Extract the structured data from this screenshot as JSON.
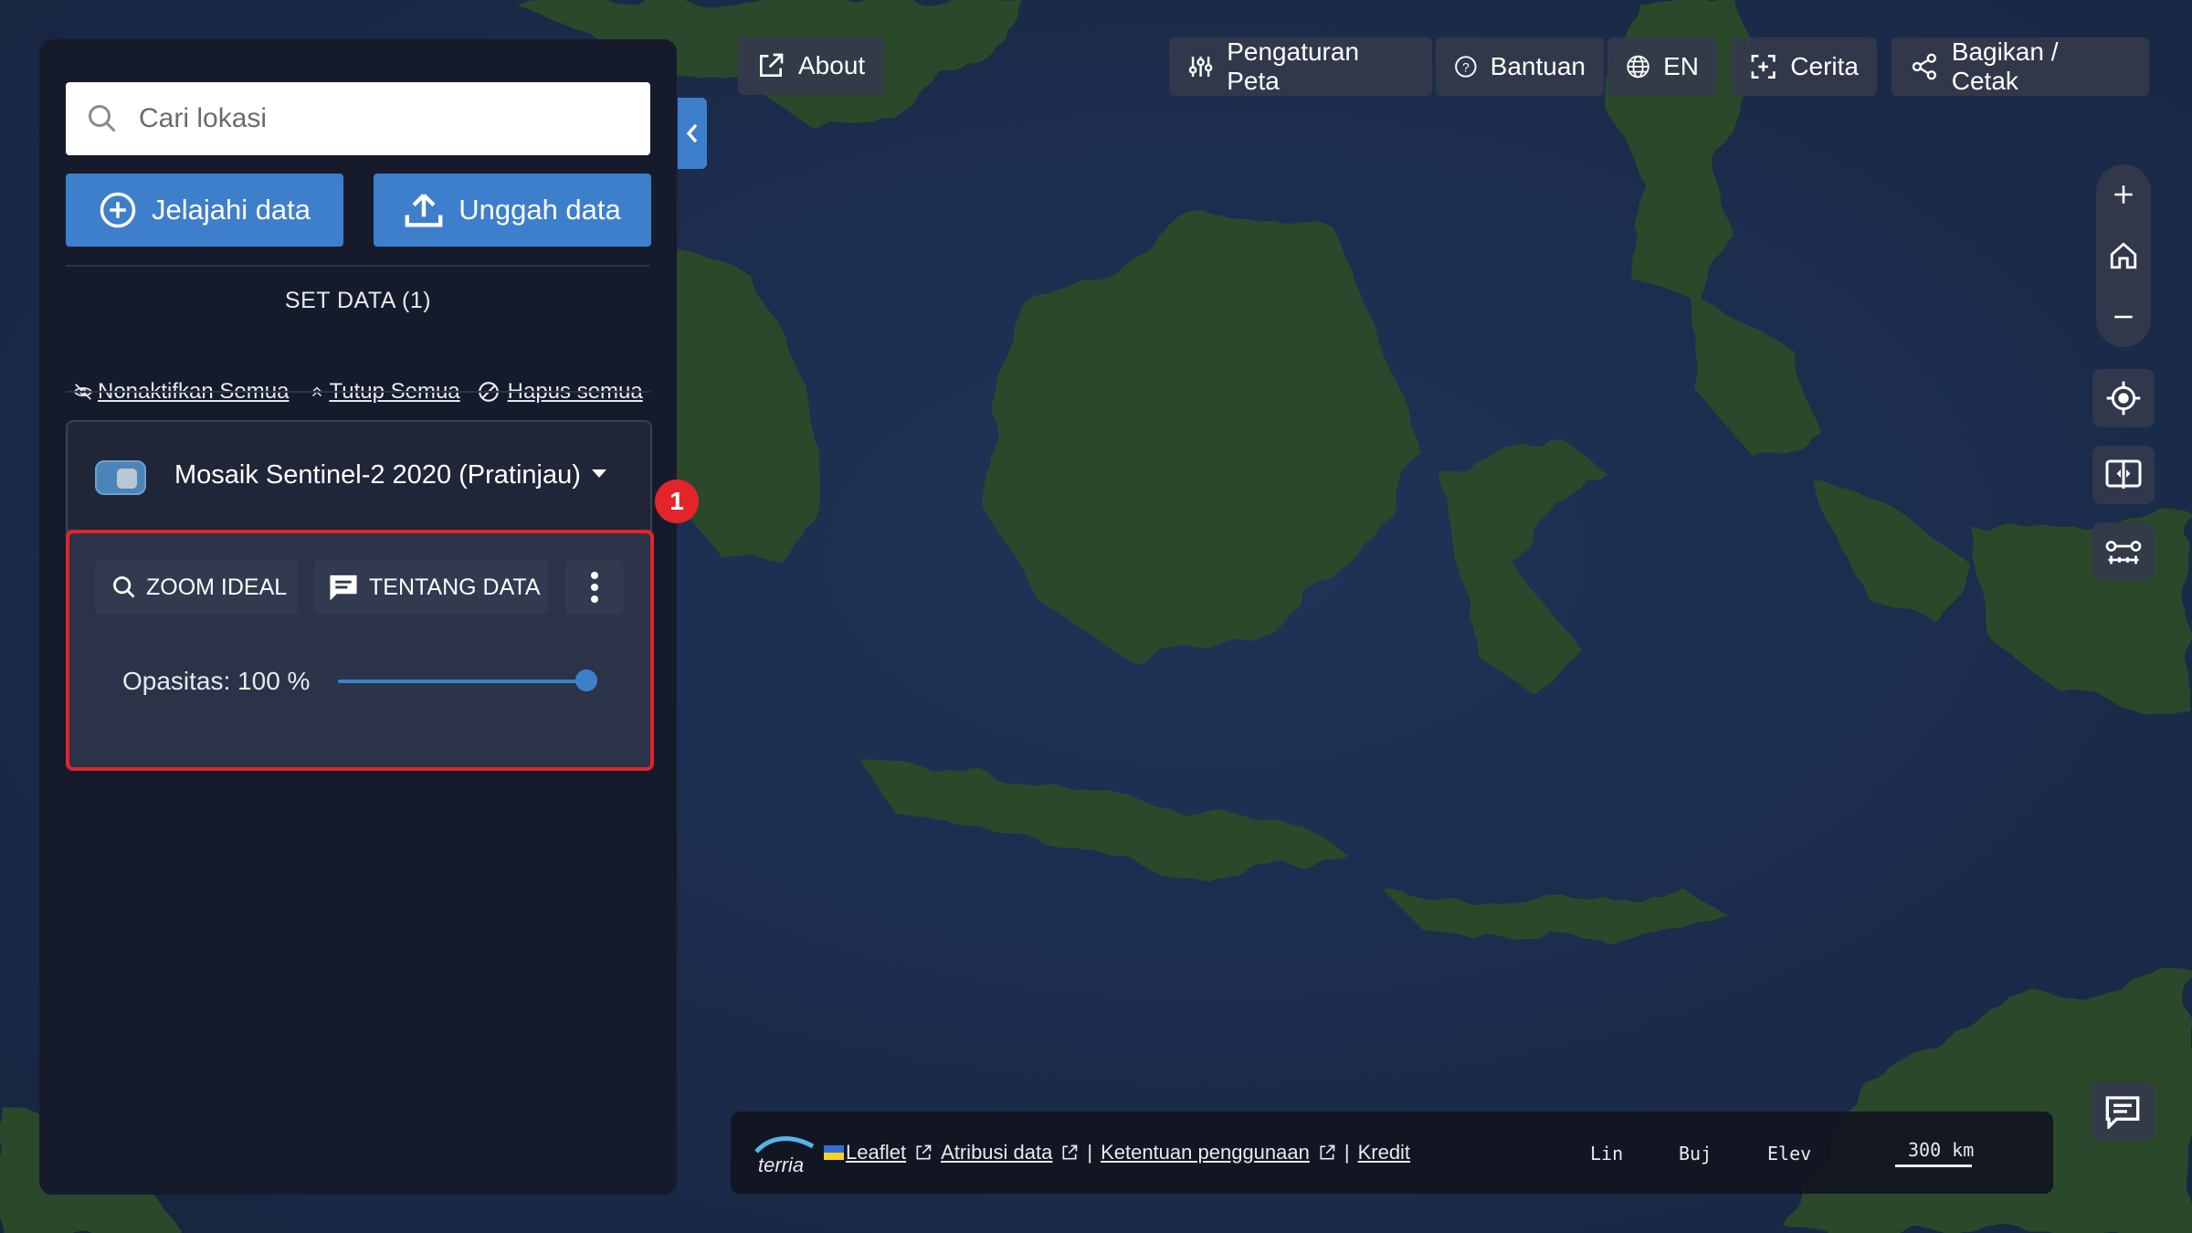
{
  "search": {
    "placeholder": "Cari lokasi"
  },
  "buttons": {
    "explore": "Jelajahi data",
    "upload": "Unggah data"
  },
  "workbench": {
    "section_title": "SET DATA (1)",
    "actions": {
      "disable_all": "Nonaktifkan Semua",
      "collapse_all": "Tutup Semua",
      "remove_all": "Hapus semua"
    },
    "item": {
      "title": "Mosaik Sentinel-2 2020 (Pratinjau)",
      "enabled": true,
      "zoom_label": "ZOOM IDEAL",
      "about_label": "TENTANG DATA",
      "opacity_label": "Opasitas: 100 %",
      "opacity_value": 1.0
    },
    "annotation_badge": "1"
  },
  "topmenu": {
    "about": "About",
    "map_settings": "Pengaturan Peta",
    "help": "Bantuan",
    "language": "EN",
    "story": "Cerita",
    "share": "Bagikan / Cetak"
  },
  "bottombar": {
    "logo_text": "terria",
    "leaflet": "Leaflet",
    "attribution": "Atribusi data",
    "terms": "Ketentuan penggunaan",
    "credits": "Kredit",
    "separator": "|",
    "lat_label": "Lin",
    "lon_label": "Buj",
    "elev_label": "Elev",
    "scale": "300 km"
  },
  "colors": {
    "accent": "#3e7fcb",
    "highlight": "#e3242b",
    "panel": "#161b2c"
  }
}
